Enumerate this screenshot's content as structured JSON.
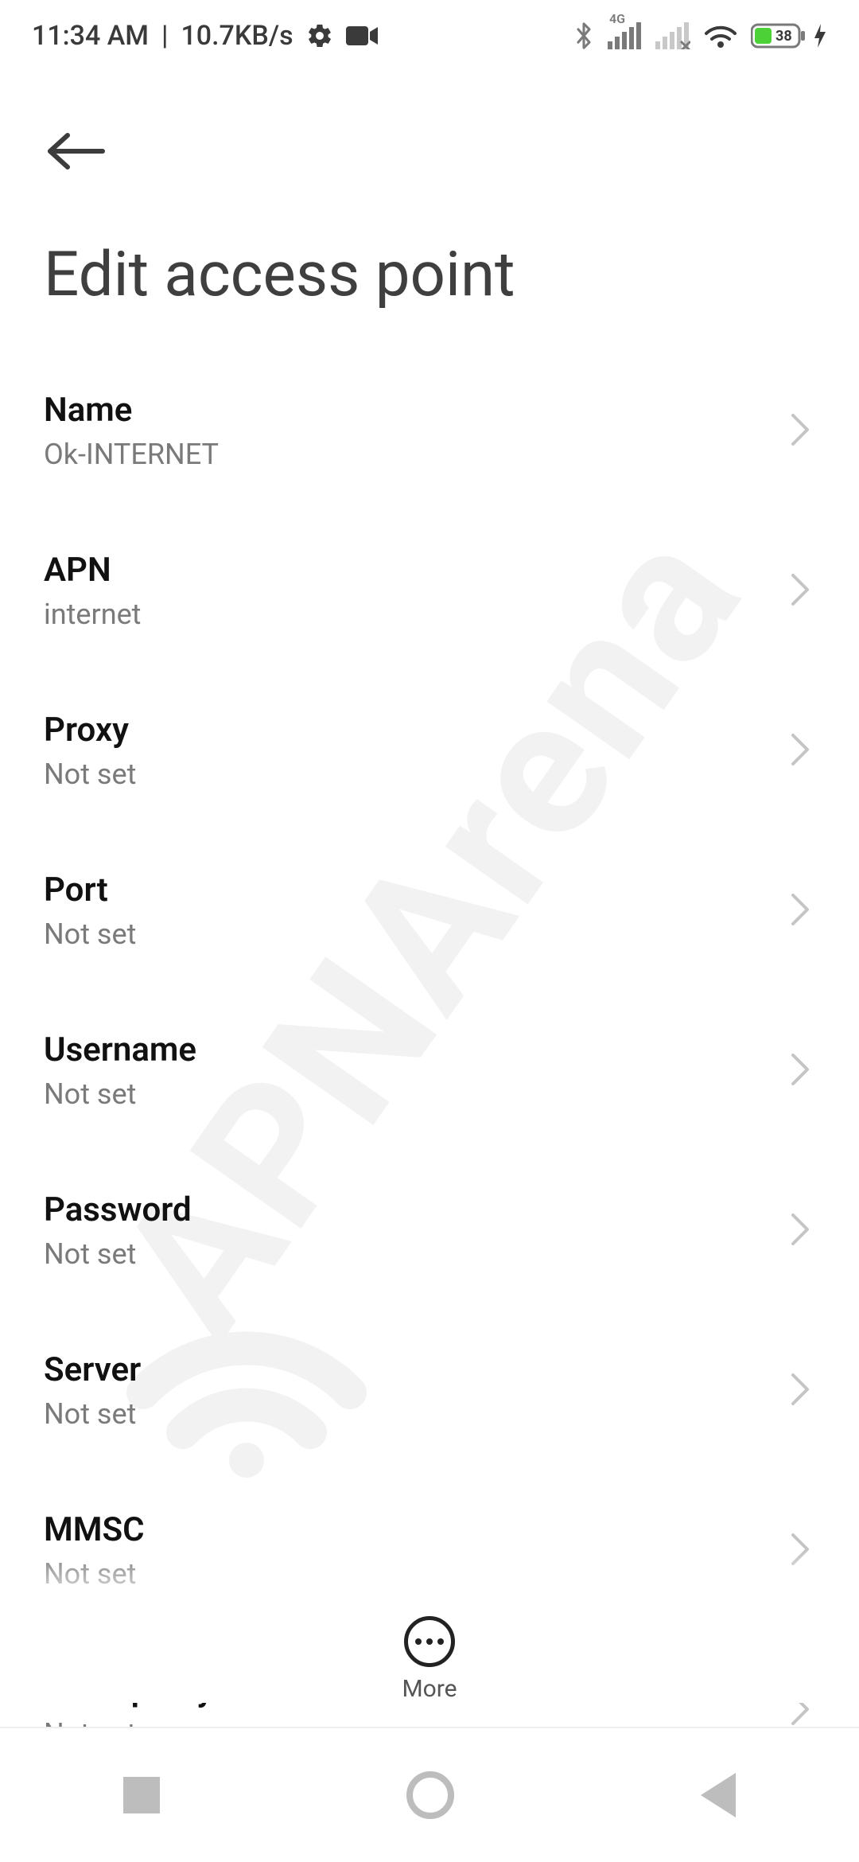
{
  "status": {
    "time": "11:34 AM",
    "separator": "|",
    "net_speed": "10.7KB/s",
    "network_badge": "4G",
    "battery_pct": "38"
  },
  "header": {
    "title": "Edit access point"
  },
  "rows": [
    {
      "label": "Name",
      "value": "Ok-INTERNET"
    },
    {
      "label": "APN",
      "value": "internet"
    },
    {
      "label": "Proxy",
      "value": "Not set"
    },
    {
      "label": "Port",
      "value": "Not set"
    },
    {
      "label": "Username",
      "value": "Not set"
    },
    {
      "label": "Password",
      "value": "Not set"
    },
    {
      "label": "Server",
      "value": "Not set"
    },
    {
      "label": "MMSC",
      "value": "Not set"
    },
    {
      "label": "MMS proxy",
      "value": "Not set"
    }
  ],
  "bottom": {
    "more_label": "More"
  },
  "watermark": "APNArena"
}
